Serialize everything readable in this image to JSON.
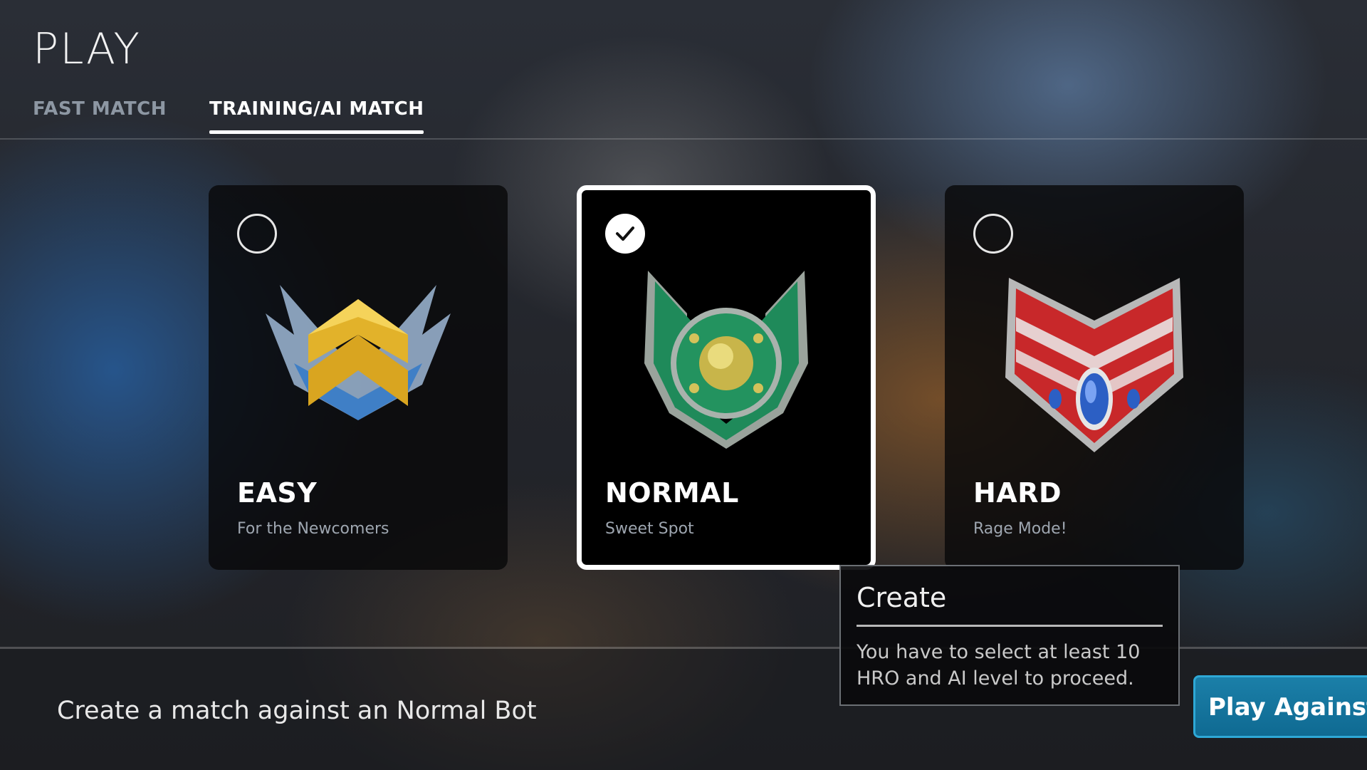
{
  "page": {
    "title": "PLAY"
  },
  "tabs": [
    {
      "label": "FAST MATCH",
      "active": false
    },
    {
      "label": "TRAINING/AI MATCH",
      "active": true
    }
  ],
  "difficulties": [
    {
      "title": "EASY",
      "subtitle": "For the Newcomers",
      "selected": false,
      "icon": "easy-emblem-icon"
    },
    {
      "title": "NORMAL",
      "subtitle": "Sweet Spot",
      "selected": true,
      "icon": "normal-emblem-icon"
    },
    {
      "title": "HARD",
      "subtitle": "Rage Mode!",
      "selected": false,
      "icon": "hard-emblem-icon"
    }
  ],
  "tooltip": {
    "title": "Create",
    "body": "You have to select at least 10 HRO and AI level  to proceed."
  },
  "footer": {
    "description": "Create a match against an Normal Bot",
    "play_button_label": "Play Against"
  },
  "colors": {
    "accent": "#1b7fa8",
    "selected_border": "#ffffff",
    "easy_emblem": "#d9a520",
    "normal_emblem": "#1f8a5a",
    "hard_emblem": "#c8282a"
  }
}
